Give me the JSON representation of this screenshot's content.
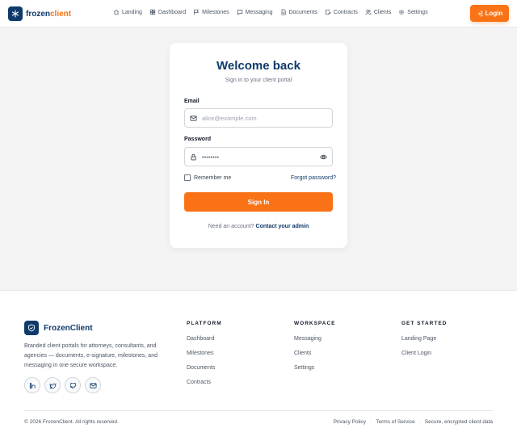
{
  "header": {
    "brand_first": "frozen",
    "brand_second": "client",
    "nav": [
      {
        "label": "Landing",
        "icon": "home-icon"
      },
      {
        "label": "Dashboard",
        "icon": "grid-icon"
      },
      {
        "label": "Milestones",
        "icon": "flag-icon"
      },
      {
        "label": "Messaging",
        "icon": "chat-icon"
      },
      {
        "label": "Documents",
        "icon": "document-icon"
      },
      {
        "label": "Contracts",
        "icon": "contract-icon"
      },
      {
        "label": "Clients",
        "icon": "users-icon"
      },
      {
        "label": "Settings",
        "icon": "gear-icon"
      }
    ],
    "login_label": "Login"
  },
  "login": {
    "title": "Welcome back",
    "subtitle": "Sign in to your client portal",
    "email_label": "Email",
    "email_placeholder": "alice@example.com",
    "password_label": "Password",
    "password_placeholder": "••••••••",
    "remember_label": "Remember me",
    "forgot_label": "Forgot password?",
    "submit_label": "Sign In",
    "need_account": "Need an account?",
    "contact_admin": "Contact your admin"
  },
  "footer": {
    "brand": "FrozenClient",
    "description": "Branded client portals for attorneys, consultants, and agencies — documents, e-signature, milestones, and messaging in one secure workspace.",
    "socials": [
      "linkedin-icon",
      "twitter-icon",
      "github-icon",
      "mail-icon"
    ],
    "columns": [
      {
        "heading": "PLATFORM",
        "links": [
          "Dashboard",
          "Milestones",
          "Documents",
          "Contracts"
        ]
      },
      {
        "heading": "WORKSPACE",
        "links": [
          "Messaging",
          "Clients",
          "Settings"
        ]
      },
      {
        "heading": "GET STARTED",
        "links": [
          "Landing Page",
          "Client Login"
        ]
      }
    ],
    "copyright": "© 2026 FrozenClient. All rights reserved.",
    "privacy": "Privacy Policy",
    "terms": "Terms of Service",
    "secure": "Secure, encrypted client data"
  },
  "colors": {
    "brand_navy": "#0f3a6b",
    "accent_orange": "#f97316"
  }
}
